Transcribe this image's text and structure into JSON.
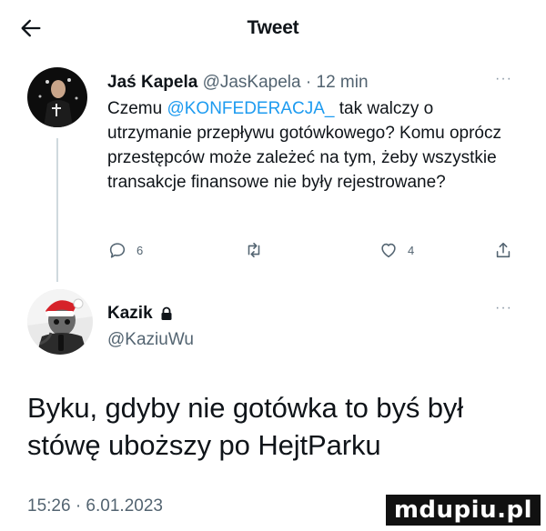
{
  "header": {
    "title": "Tweet"
  },
  "tweet1": {
    "name": "Jaś Kapela",
    "handle": "@JasKapela",
    "time": "· 12 min",
    "text_pre": "Czemu ",
    "mention": "@KONFEDERACJA_",
    "text_post": " tak walczy o utrzymanie przepływu gotówkowego? Komu oprócz przestępców może zależeć na tym, żeby wszystkie transakcje finansowe nie były rejestrowane?",
    "reply_count": "6",
    "like_count": "4"
  },
  "tweet2": {
    "name": "Kazik",
    "handle": "@KaziuWu",
    "text": "Byku, gdyby nie gotówka to byś był stówę uboższy po HejtParku",
    "timestamp": "15:26 · 6.01.2023"
  },
  "watermark": "mdupiu.pl",
  "icons": {
    "back": "arrow-left-icon",
    "reply": "reply-icon",
    "retweet": "retweet-icon",
    "like": "heart-icon",
    "share": "share-icon",
    "lock": "lock-icon",
    "more": "more-icon"
  },
  "colors": {
    "link": "#1d9bf0",
    "secondary": "#536471",
    "text": "#0f1419"
  }
}
